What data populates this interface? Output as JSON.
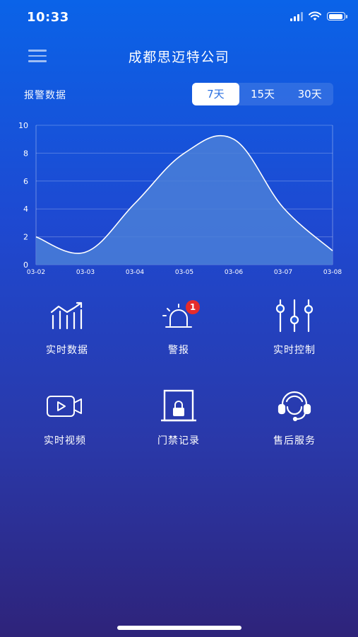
{
  "status_bar": {
    "time": "10:33"
  },
  "header": {
    "title": "成都思迈特公司",
    "menu_icon": "hamburger-menu-icon"
  },
  "alarm_section": {
    "label": "报警数据",
    "tabs": [
      {
        "label": "7天",
        "active": true
      },
      {
        "label": "15天",
        "active": false
      },
      {
        "label": "30天",
        "active": false
      }
    ]
  },
  "chart_data": {
    "type": "area",
    "title": "",
    "xlabel": "",
    "ylabel": "",
    "x": [
      "03-02",
      "03-03",
      "03-04",
      "03-05",
      "03-06",
      "03-07",
      "03-08"
    ],
    "y": [
      2.0,
      0.9,
      4.4,
      8.0,
      9.0,
      4.1,
      1.0
    ],
    "ylim": [
      0,
      10
    ],
    "yticks": [
      0,
      2,
      4,
      6,
      8,
      10
    ],
    "grid": true,
    "fill_color": "#4a7fd8",
    "line_color": "#ffffff"
  },
  "menu": [
    {
      "label": "实时数据",
      "icon": "chart-trend-icon"
    },
    {
      "label": "警报",
      "icon": "alarm-light-icon",
      "badge": "1"
    },
    {
      "label": "实时控制",
      "icon": "sliders-icon"
    },
    {
      "label": "实时视频",
      "icon": "video-camera-icon"
    },
    {
      "label": "门禁记录",
      "icon": "door-lock-icon"
    },
    {
      "label": "售后服务",
      "icon": "headset-support-icon"
    }
  ],
  "colors": {
    "badge": "#e52b2b",
    "active_tab_text": "#2a6fe0"
  }
}
